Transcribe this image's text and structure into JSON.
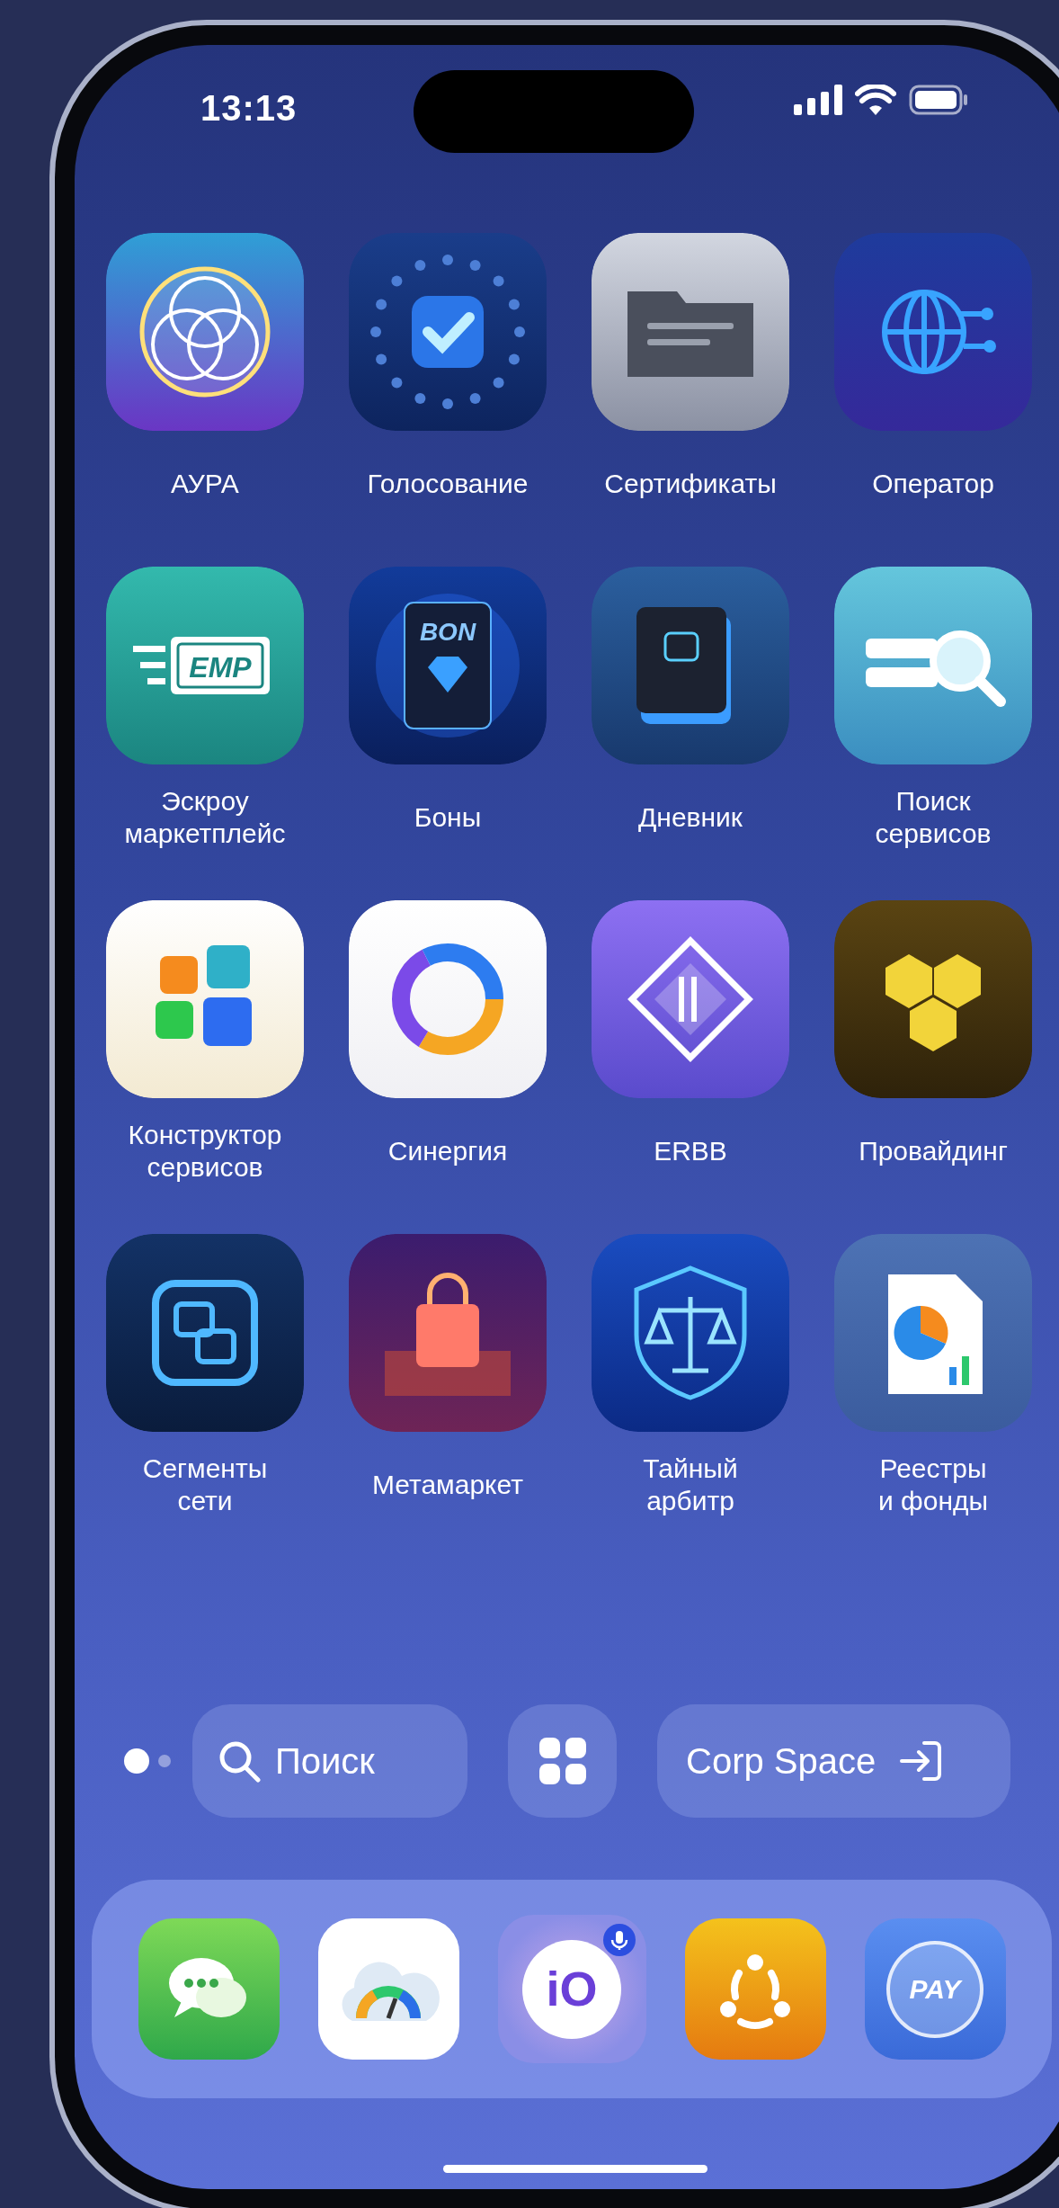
{
  "status_bar": {
    "time": "13:13"
  },
  "apps": [
    {
      "kind": "aura",
      "label": "АУРА"
    },
    {
      "kind": "voting",
      "label": "Голосование"
    },
    {
      "kind": "certificates",
      "label": "Сертификаты"
    },
    {
      "kind": "operator",
      "label": "Оператор"
    },
    {
      "kind": "escrow",
      "label": "Эскроу\nмаркетплейс",
      "icon_text": "EMP"
    },
    {
      "kind": "bons",
      "label": "Боны",
      "icon_text": "BON"
    },
    {
      "kind": "diary",
      "label": "Дневник"
    },
    {
      "kind": "service-search",
      "label": "Поиск\nсервисов"
    },
    {
      "kind": "constructor",
      "label": "Конструктор\nсервисов"
    },
    {
      "kind": "synergy",
      "label": "Синергия"
    },
    {
      "kind": "erbb",
      "label": "ERBB"
    },
    {
      "kind": "providing",
      "label": "Провайдинг"
    },
    {
      "kind": "segments",
      "label": "Сегменты\nсети"
    },
    {
      "kind": "metamarket",
      "label": "Метамаркет"
    },
    {
      "kind": "arbiter",
      "label": "Тайный\nарбитр"
    },
    {
      "kind": "registries",
      "label": "Реестры\nи фонды"
    }
  ],
  "page_dots": [
    {
      "selected": true
    },
    {
      "selected": false
    }
  ],
  "search": {
    "label": "Поиск"
  },
  "corp_space": {
    "label": "Corp Space"
  },
  "dock": [
    {
      "kind": "chat"
    },
    {
      "kind": "gauge"
    },
    {
      "kind": "assistant",
      "text": "iO"
    },
    {
      "kind": "people"
    },
    {
      "kind": "pay",
      "text": "PAY"
    }
  ]
}
